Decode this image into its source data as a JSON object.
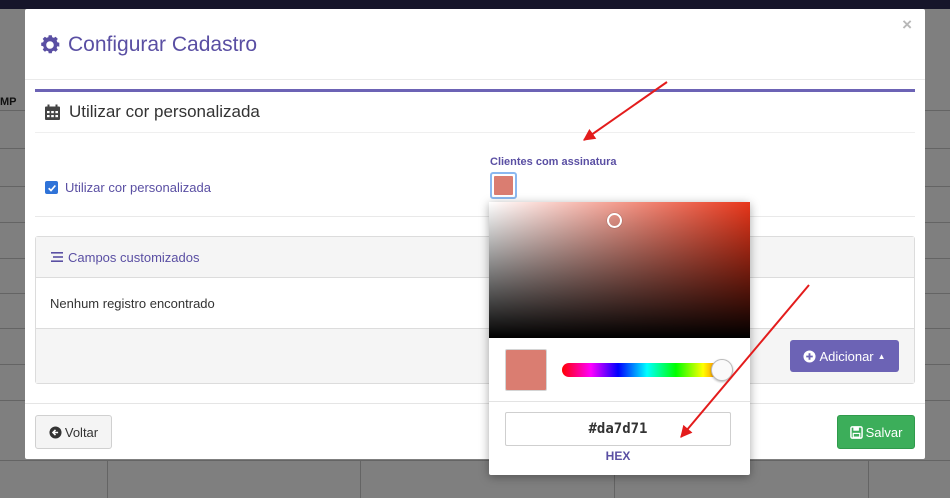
{
  "background": {
    "column_header": "MP"
  },
  "modal": {
    "title": "Configurar Cadastro",
    "close_label": "×",
    "section": {
      "title": "Utilizar cor personalizada",
      "checkbox_label": "Utilizar cor personalizada",
      "checkbox_checked": true,
      "color_field_label": "Clientes com assinatura",
      "color_value": "#da7d71"
    },
    "custom_fields": {
      "title": "Campos customizados",
      "empty_message": "Nenhum registro encontrado",
      "add_button": "Adicionar"
    },
    "footer": {
      "back_button": "Voltar",
      "save_button": "Salvar"
    }
  },
  "color_picker": {
    "hex_value": "#da7d71",
    "mode_label": "HEX"
  },
  "colors": {
    "accent": "#6c63b5",
    "title": "#5a4fa3",
    "selected_color": "#da7d71",
    "save": "#3cae5a",
    "checkbox": "#2f73d8",
    "arrow": "#e31c1c"
  },
  "icons": [
    "gear-icon",
    "calendar-icon",
    "check-icon",
    "list-icon",
    "plus-circle-icon",
    "caret-up-icon",
    "arrow-left-circle-icon",
    "save-icon"
  ]
}
